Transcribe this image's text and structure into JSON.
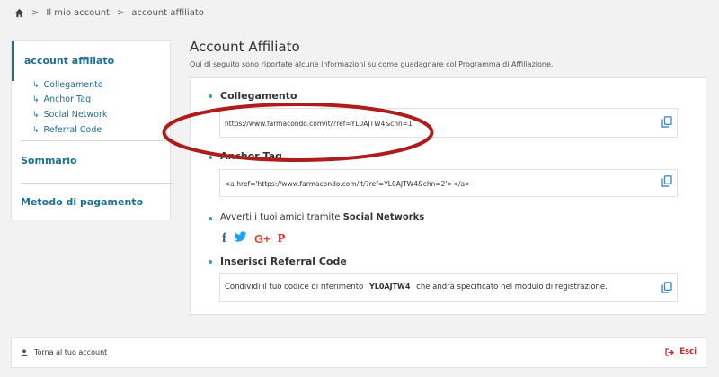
{
  "breadcrumb": {
    "items": [
      "Il mio account",
      "account affiliato"
    ]
  },
  "sidebar": {
    "active": "account affiliato",
    "subitems": [
      "Collegamento",
      "Anchor Tag",
      "Social Network",
      "Referral Code"
    ],
    "summary": "Sommario",
    "payment": "Metodo di pagamento"
  },
  "main": {
    "title": "Account Affiliato",
    "subtitle": "Qui di seguito sono riportate alcune informazioni su come guadagnare col Programma di Affiliazione.",
    "link": {
      "title": "Collegamento",
      "value": "https://www.farmacondo.com/it/?ref=YL0AJTW4&chn=1"
    },
    "anchor": {
      "title": "Anchor Tag",
      "value": "<a href='https://www.farmacondo.com/it/?ref=YL0AJTW4&chn=2'></a>"
    },
    "social": {
      "text_before": "Avverti i tuoi amici tramite",
      "text_bold": "Social Networks",
      "icons": [
        "facebook-icon",
        "twitter-icon",
        "google-plus-icon",
        "pinterest-icon"
      ],
      "facebook": "f",
      "googleplus": "G+",
      "pinterest": "P"
    },
    "referral": {
      "title": "Inserisci Referral Code",
      "text_before": "Condividi il tuo codice di riferimento",
      "code": "YL0AJTW4",
      "text_after": "che andrà specificato nel modulo di registrazione."
    }
  },
  "footer": {
    "back": "Torna al tuo account",
    "logout": "Esci"
  },
  "colors": {
    "accent": "#1f6f8f",
    "bullet": "#4a90c8",
    "logout": "#cc2a2a",
    "annotation": "#b01c1c"
  }
}
